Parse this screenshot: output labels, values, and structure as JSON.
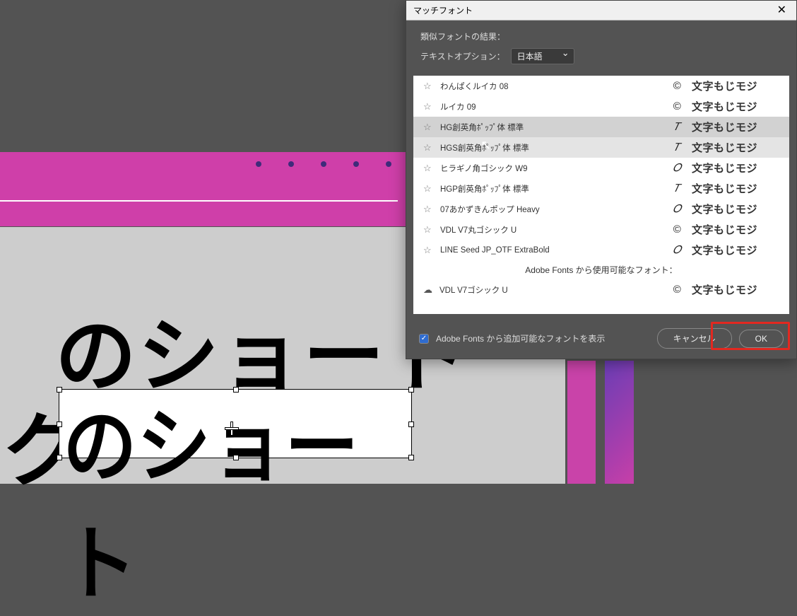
{
  "dialog": {
    "title": "マッチフォント",
    "result_label": "類似フォントの結果：",
    "text_opts_label": "テキストオプション：",
    "language": "日本語",
    "show_adobe_fonts_label": "Adobe Fonts から追加可能なフォントを表示",
    "cancel": "キャンセル",
    "ok": "OK"
  },
  "font_separator": "Adobe Fonts から使用可能なフォント：",
  "fonts": [
    {
      "name": "わんぱくルイカ 08",
      "icon": "cc",
      "preview": "文字もじモジ"
    },
    {
      "name": "ルイカ 09",
      "icon": "cc",
      "preview": "文字もじモジ"
    },
    {
      "name": "HG創英角ﾎﾟｯﾌﾟ体 標準",
      "icon": "tt",
      "preview": "文字もじモジ",
      "selected": true
    },
    {
      "name": "HGS創英角ﾎﾟｯﾌﾟ体 標準",
      "icon": "tt",
      "preview": "文字もじモジ",
      "hover": true
    },
    {
      "name": "ヒラギノ角ゴシック W9",
      "icon": "o",
      "preview": "文字もじモジ"
    },
    {
      "name": "HGP創英角ﾎﾟｯﾌﾟ体 標準",
      "icon": "tt",
      "preview": "文字もじモジ"
    },
    {
      "name": "07あかずきんポップ Heavy",
      "icon": "o",
      "preview": "文字もじモジ"
    },
    {
      "name": "VDL V7丸ゴシック U",
      "icon": "cc",
      "preview": "文字もじモジ"
    },
    {
      "name": "LINE Seed JP_OTF ExtraBold",
      "icon": "o",
      "preview": "文字もじモジ"
    }
  ],
  "cloud_fonts": [
    {
      "name": "VDL V7ゴシック U",
      "icon": "cc",
      "preview": "文字もじモジ"
    }
  ],
  "glyphs": {
    "star": "☆",
    "cloud": "☁",
    "check": "✓",
    "close": "✕",
    "tt": "𝑇",
    "cc": "©",
    "o": "𝑂"
  },
  "canvas": {
    "text1": "のショート",
    "text2": "のショート",
    "text_left": "ク"
  }
}
